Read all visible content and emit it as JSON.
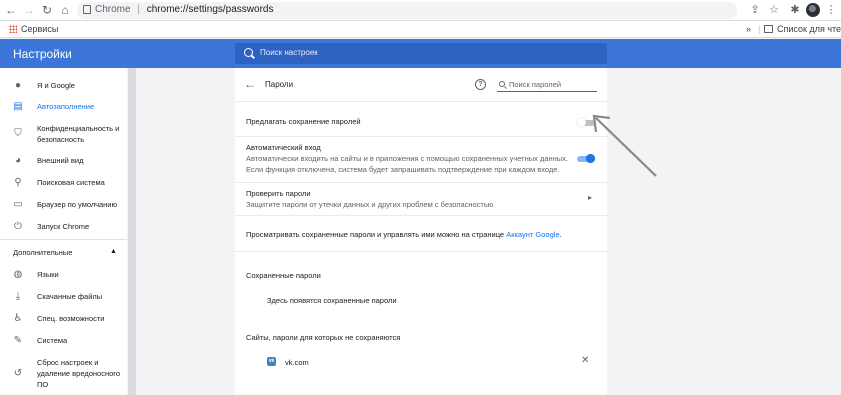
{
  "browser": {
    "url_prefix": "Chrome",
    "url_separator": "|",
    "url_path": "chrome://settings/passwords"
  },
  "bookmarks": {
    "apps_label": "Сервисы",
    "reading_list_label": "Список для чтения",
    "more_label": "»"
  },
  "header": {
    "title": "Настройки",
    "search_placeholder": "Поиск настроек"
  },
  "sidebar": {
    "items": [
      {
        "label": "Я и Google",
        "icon": "person-icon"
      },
      {
        "label": "Автозаполнение",
        "icon": "autofill-icon"
      },
      {
        "label": "Конфиденциальность и безопасность",
        "icon": "shield-icon"
      },
      {
        "label": "Внешний вид",
        "icon": "palette-icon"
      },
      {
        "label": "Поисковая система",
        "icon": "search-icon"
      },
      {
        "label": "Браузер по умолчанию",
        "icon": "browser-icon"
      },
      {
        "label": "Запуск Chrome",
        "icon": "power-icon"
      }
    ],
    "section_label": "Дополнительные",
    "advanced_items": [
      {
        "label": "Языки",
        "icon": "globe-icon"
      },
      {
        "label": "Скачанные файлы",
        "icon": "download-icon"
      },
      {
        "label": "Спец. возможности",
        "icon": "accessibility-icon"
      },
      {
        "label": "Система",
        "icon": "wrench-icon"
      },
      {
        "label": "Сброс настроек и удаление вредоносного ПО",
        "icon": "restore-icon"
      }
    ]
  },
  "passwords": {
    "title": "Пароли",
    "search_placeholder": "Поиск паролей",
    "offer_to_save_label": "Предлагать сохранение паролей",
    "offer_to_save_on": false,
    "auto_signin_label": "Автоматический вход",
    "auto_signin_desc_1": "Автоматически входить на сайты и в приложения с помощью сохраненных учетных данных.",
    "auto_signin_desc_2": "Если функция отключена, система будет запрашивать подтверждение при каждом входе.",
    "auto_signin_on": true,
    "check_label": "Проверить пароли",
    "check_desc": "Защитите пароли от утечки данных и других проблем с безопасностью",
    "manage_text": "Просматривать сохраненные пароли и управлять ими можно на странице",
    "manage_link": "Аккаунт Google",
    "manage_tail": ".",
    "saved_title": "Сохраненные пароли",
    "saved_empty": "Здесь появятся сохраненные пароли",
    "never_saved_title": "Сайты, пароли для которых не сохраняются",
    "never_saved_items": [
      "vk.com"
    ]
  },
  "colors": {
    "header_blue": "#3c76d8",
    "accent": "#1a73e8",
    "annotation_arrow": "#8a8a8a"
  }
}
